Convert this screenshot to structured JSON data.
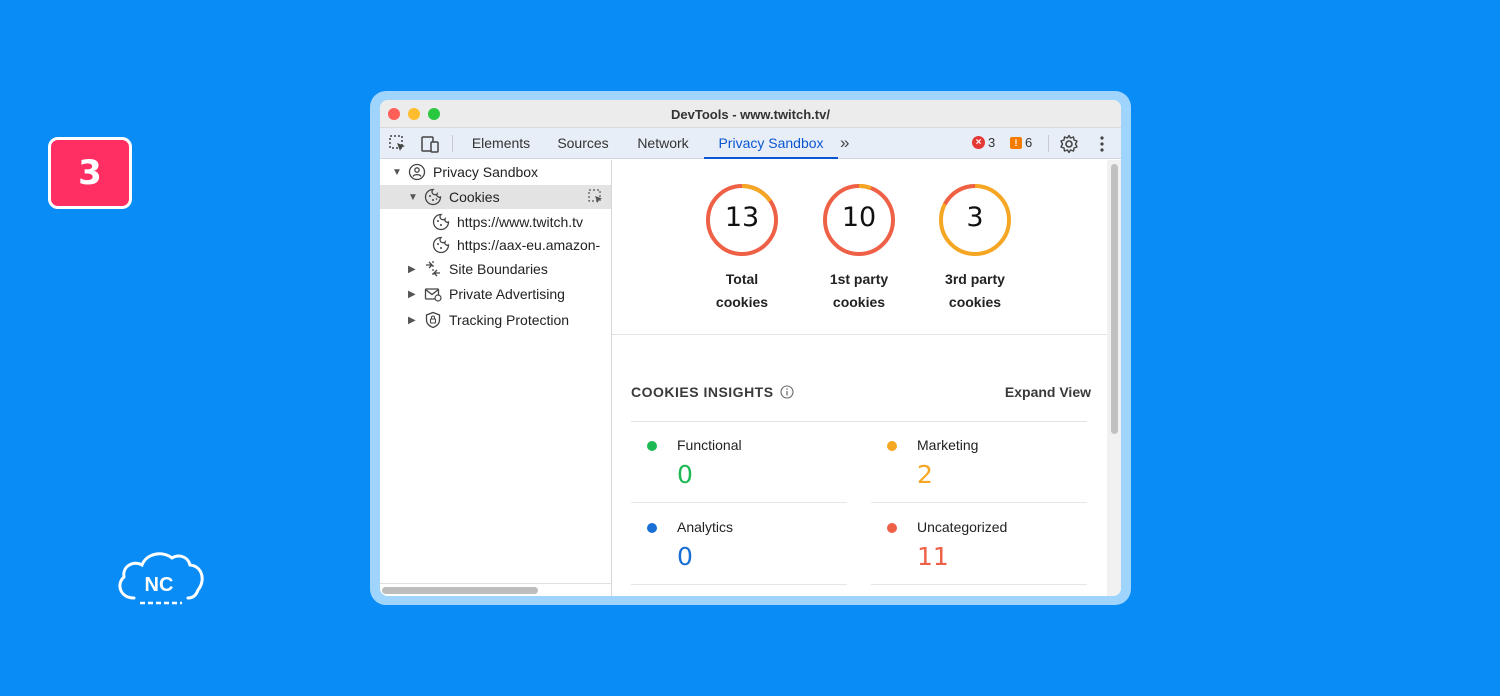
{
  "step_badge": "3",
  "brand": {
    "logo_text": "NC"
  },
  "window": {
    "title": "DevTools - www.twitch.tv/"
  },
  "toolbar": {
    "tabs": [
      {
        "label": "Elements"
      },
      {
        "label": "Sources"
      },
      {
        "label": "Network"
      },
      {
        "label": "Privacy Sandbox",
        "active": true
      }
    ],
    "more_tabs": "»",
    "errors": "3",
    "warnings": "6"
  },
  "sidebar": {
    "items": [
      {
        "label": "Privacy Sandbox",
        "expanded": true
      },
      {
        "label": "Cookies",
        "expanded": true,
        "selected": true
      },
      {
        "label": "https://www.twitch.tv"
      },
      {
        "label": "https://aax-eu.amazon-"
      },
      {
        "label": "Site Boundaries",
        "expanded": false
      },
      {
        "label": "Private Advertising",
        "expanded": false
      },
      {
        "label": "Tracking Protection",
        "expanded": false
      }
    ]
  },
  "summary": [
    {
      "value": "13",
      "label_line1": "Total",
      "label_line2": "cookies"
    },
    {
      "value": "10",
      "label_line1": "1st party",
      "label_line2": "cookies"
    },
    {
      "value": "3",
      "label_line1": "3rd party",
      "label_line2": "cookies"
    }
  ],
  "insights": {
    "title": "COOKIES INSIGHTS",
    "expand_label": "Expand View",
    "categories": [
      {
        "name": "Functional",
        "value": "0",
        "color": "#1db954"
      },
      {
        "name": "Marketing",
        "value": "2",
        "color": "#f5a623"
      },
      {
        "name": "Analytics",
        "value": "0",
        "color": "#1a6fd6"
      },
      {
        "name": "Uncategorized",
        "value": "11",
        "color": "#ee6147"
      }
    ]
  },
  "colors": {
    "background": "#0a8cf7",
    "badge": "#ff2e63",
    "accent": "#0b57d0",
    "ring_orange": "#ee6147",
    "ring_yellow": "#f5a623"
  }
}
